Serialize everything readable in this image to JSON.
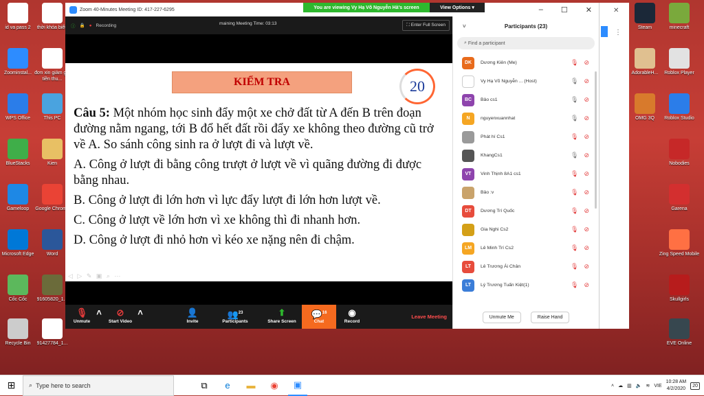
{
  "desktop": {
    "left_icons": [
      {
        "label": "id va pass 2",
        "icon": "document-icon",
        "color": "#ffffff"
      },
      {
        "label": "thời khóa biểu",
        "icon": "document-icon",
        "color": "#ffffff"
      },
      {
        "label": "Zoominstal...",
        "icon": "zoom-icon",
        "color": "#2d8cff"
      },
      {
        "label": "đơn xin giảm giá tiền thu...",
        "icon": "word-icon",
        "color": "#ffffff"
      },
      {
        "label": "WPS Office",
        "icon": "wps-icon",
        "color": "#2b7de9"
      },
      {
        "label": "This PC",
        "icon": "computer-icon",
        "color": "#4aa3df"
      },
      {
        "label": "BlueStacks",
        "icon": "bluestacks-icon",
        "color": "#3fae49"
      },
      {
        "label": "Kien",
        "icon": "user-folder-icon",
        "color": "#e8c064"
      },
      {
        "label": "Gameloop",
        "icon": "gameloop-icon",
        "color": "#1e88e5"
      },
      {
        "label": "Google Chrome",
        "icon": "chrome-icon",
        "color": "#ea4335"
      },
      {
        "label": "Microsoft Edge",
        "icon": "edge-icon",
        "color": "#0078d7"
      },
      {
        "label": "Word",
        "icon": "word-icon",
        "color": "#2b579a"
      },
      {
        "label": "Cốc Cốc",
        "icon": "coccoc-icon",
        "color": "#5cb85c"
      },
      {
        "label": "91605820_1...",
        "icon": "image-icon",
        "color": "#6b6b3a"
      },
      {
        "label": "Recycle Bin",
        "icon": "recycle-bin-icon",
        "color": "#cccccc"
      },
      {
        "label": "91427784_1...",
        "icon": "image-icon",
        "color": "#ffffff"
      }
    ],
    "right_icons": [
      {
        "label": "Steam",
        "icon": "steam-icon",
        "color": "#1b2838"
      },
      {
        "label": "minecraft",
        "icon": "minecraft-icon",
        "color": "#7aa93c"
      },
      {
        "label": "AdorableH...",
        "icon": "image-icon",
        "color": "#e0c090"
      },
      {
        "label": "Roblox Player",
        "icon": "roblox-icon",
        "color": "#e2e2e2"
      },
      {
        "label": "OMG 3Q",
        "icon": "game-icon",
        "color": "#d87a2c"
      },
      {
        "label": "Roblox Studio",
        "icon": "roblox-studio-icon",
        "color": "#2b7de9"
      },
      {
        "label": "Nobodies",
        "icon": "game-icon",
        "color": "#c62828"
      },
      {
        "label": "Garena",
        "icon": "garena-icon",
        "color": "#d32f2f"
      },
      {
        "label": "Zing Speed Mobile",
        "icon": "game-icon",
        "color": "#ff7043"
      },
      {
        "label": "Skullgirls",
        "icon": "game-icon",
        "color": "#b71c1c"
      },
      {
        "label": "EVE Online",
        "icon": "eve-icon",
        "color": "#37474f"
      }
    ]
  },
  "zoom": {
    "title": "Zoom 40-Minutes Meeting ID: 417-227-6295",
    "banner_text": "You are viewing Vy Hạ Võ Nguyễn Hà's screen",
    "view_options": "View Options",
    "recording": "Recording",
    "time_label": "maining Meeting Time: 03:13",
    "fullscreen": "Enter Full Screen",
    "slide": {
      "heading": "KIỂM TRA",
      "timer": "20",
      "question_label": "Câu 5:",
      "question": "Một nhóm học sinh đẩy một xe chở đất từ A đến B trên đoạn đường nằm ngang, tới B đổ hết đất rồi đẩy xe không theo đường cũ trở về A. So sánh công sinh ra ở lượt đi và lượt về.",
      "options": [
        "A. Công ở lượt đi bằng công trượt ở lượt về vì quãng đường đi được bằng nhau.",
        "B. Công ở lượt đi lớn hơn vì lực đẩy lượt đi lớn hơn lượt về.",
        "C. Công ở lượt về lớn hơn vì xe không thì đi nhanh hơn.",
        "D. Công ở lượt đi nhỏ hơn vì kéo xe nặng nên đi chậm."
      ]
    },
    "toolbar": {
      "unmute": "Unmute",
      "start_video": "Start Video",
      "invite": "Invite",
      "participants": "Participants",
      "participants_count": "23",
      "share_screen": "Share Screen",
      "chat": "Chat",
      "chat_count": "16",
      "record": "Record",
      "leave": "Leave Meeting"
    },
    "panel": {
      "title": "Participants (23)",
      "search_placeholder": "Find a participant",
      "participants": [
        {
          "initials": "DK",
          "name": "Dương Kiên (Me)",
          "color": "#e86b1c",
          "muted": true
        },
        {
          "initials": "",
          "name": "Vy Hạ Võ Nguyễn ... (Host)",
          "color": "#ffffff",
          "muted": false
        },
        {
          "initials": "BC",
          "name": "Bảo cs1",
          "color": "#8e44ad",
          "muted": false
        },
        {
          "initials": "N",
          "name": "nguyenxuannhat",
          "color": "#f5a623",
          "muted": false
        },
        {
          "initials": "",
          "name": "Phát hí Cs1",
          "color": "#9a9a9a",
          "muted": true
        },
        {
          "initials": "",
          "name": "KhangCs1",
          "color": "#555555",
          "muted": false
        },
        {
          "initials": "VT",
          "name": "Vinh Thịnh 8A1 cs1",
          "color": "#8e44ad",
          "muted": true
        },
        {
          "initials": "",
          "name": "Bảo :v",
          "color": "#c9a36b",
          "muted": true
        },
        {
          "initials": "DT",
          "name": "Dương Trí Quốc",
          "color": "#e74c3c",
          "muted": true
        },
        {
          "initials": "",
          "name": "Gia Nghi Cs2",
          "color": "#d4a017",
          "muted": true
        },
        {
          "initials": "LM",
          "name": "Lê Minh Trí Cs2",
          "color": "#f5a623",
          "muted": true
        },
        {
          "initials": "LT",
          "name": "Lê Trương Ái Chân",
          "color": "#e74c3c",
          "muted": true
        },
        {
          "initials": "LT",
          "name": "Lý Trương Tuấn Kiệt(1)",
          "color": "#3b7dd8",
          "muted": true
        }
      ],
      "unmute_me": "Unmute Me",
      "raise_hand": "Raise Hand"
    }
  },
  "taskbar": {
    "search_placeholder": "Type here to search",
    "lang": "VIE",
    "time": "10:28 AM",
    "date": "4/2/2020",
    "notifications": "20"
  }
}
